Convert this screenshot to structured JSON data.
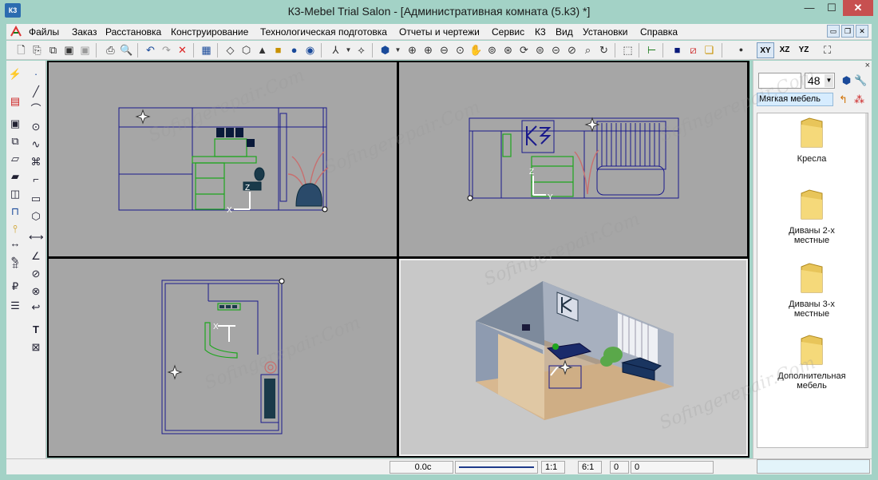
{
  "window": {
    "title": "К3-Mebel Trial Salon - [Административная комната (5.k3) *]",
    "icon_label": "К3",
    "minimize_glyph": "—",
    "maximize_glyph": "☐",
    "close_glyph": "✕"
  },
  "menu": {
    "items": [
      "Файлы",
      "Заказ",
      "Расстановка",
      "Конструирование",
      "Технологическая подготовка",
      "Отчеты и чертежи",
      "Сервис",
      "К3",
      "Вид",
      "Установки",
      "Справка"
    ]
  },
  "toolbar": {
    "icons": [
      "new-file-icon",
      "open-icon",
      "open-template-icon",
      "save-icon",
      "save-disabled-icon",
      "print-icon",
      "print-preview-icon",
      "undo-icon",
      "redo-icon",
      "delete-icon",
      "grid-icon",
      "view-wire-icon",
      "view-box-icon",
      "view-solid-icon",
      "view-render-icon",
      "view-sphere-icon",
      "axes-icon",
      "axes-dropdown-icon",
      "perspective-icon",
      "cube-icon",
      "cube-dropdown-icon",
      "zoom-icon",
      "zoom-in-icon",
      "zoom-out-icon",
      "pan-icon",
      "zoom-window-icon",
      "rotate-icon",
      "zoom-all-icon",
      "zoom-extent-icon",
      "fit-icon",
      "tree-icon",
      "color-fill-icon",
      "no-color-icon",
      "layers-icon",
      "dot-icon"
    ],
    "planes": [
      "XY",
      "XZ",
      "YZ"
    ],
    "fullscreen_icon": "fullscreen-icon"
  },
  "left_tools": [
    "polyline-icon",
    "point-icon",
    "line-icon",
    "arc-icon",
    "circle-icon",
    "curve-icon",
    "spline-icon",
    "fillet-icon",
    "rectangle-icon",
    "polygon-icon",
    "panel-icon",
    "box-icon",
    "door-icon",
    "handle-icon",
    "cabinet-icon",
    "shelf-icon",
    "dimension-icon",
    "angle-dim-icon",
    "label-icon",
    "price-icon",
    "rotate-icon",
    "list-icon",
    "text-icon",
    "hatch-icon",
    "measure-icon",
    "edit-icon"
  ],
  "right_panel": {
    "size_value": "48",
    "category": "Мягкая мебель",
    "close_glyph": "×",
    "items": [
      {
        "label": "Кресла"
      },
      {
        "label": "Диваны 2-х местные"
      },
      {
        "label": "Диваны 3-х местные"
      },
      {
        "label": "Дополнительная мебель"
      }
    ]
  },
  "status": {
    "time": "0.0c",
    "scale": "1:1",
    "ratio": "6:1",
    "v1": "0",
    "v2": "0"
  },
  "watermark": "Sofingerepair.Com",
  "colors": {
    "viewport_bg": "#a6a6a6",
    "wire": "#1a1a8c",
    "green": "#1ea61e"
  },
  "axis_labels": {
    "x": "X",
    "y": "Y",
    "z": "Z"
  }
}
